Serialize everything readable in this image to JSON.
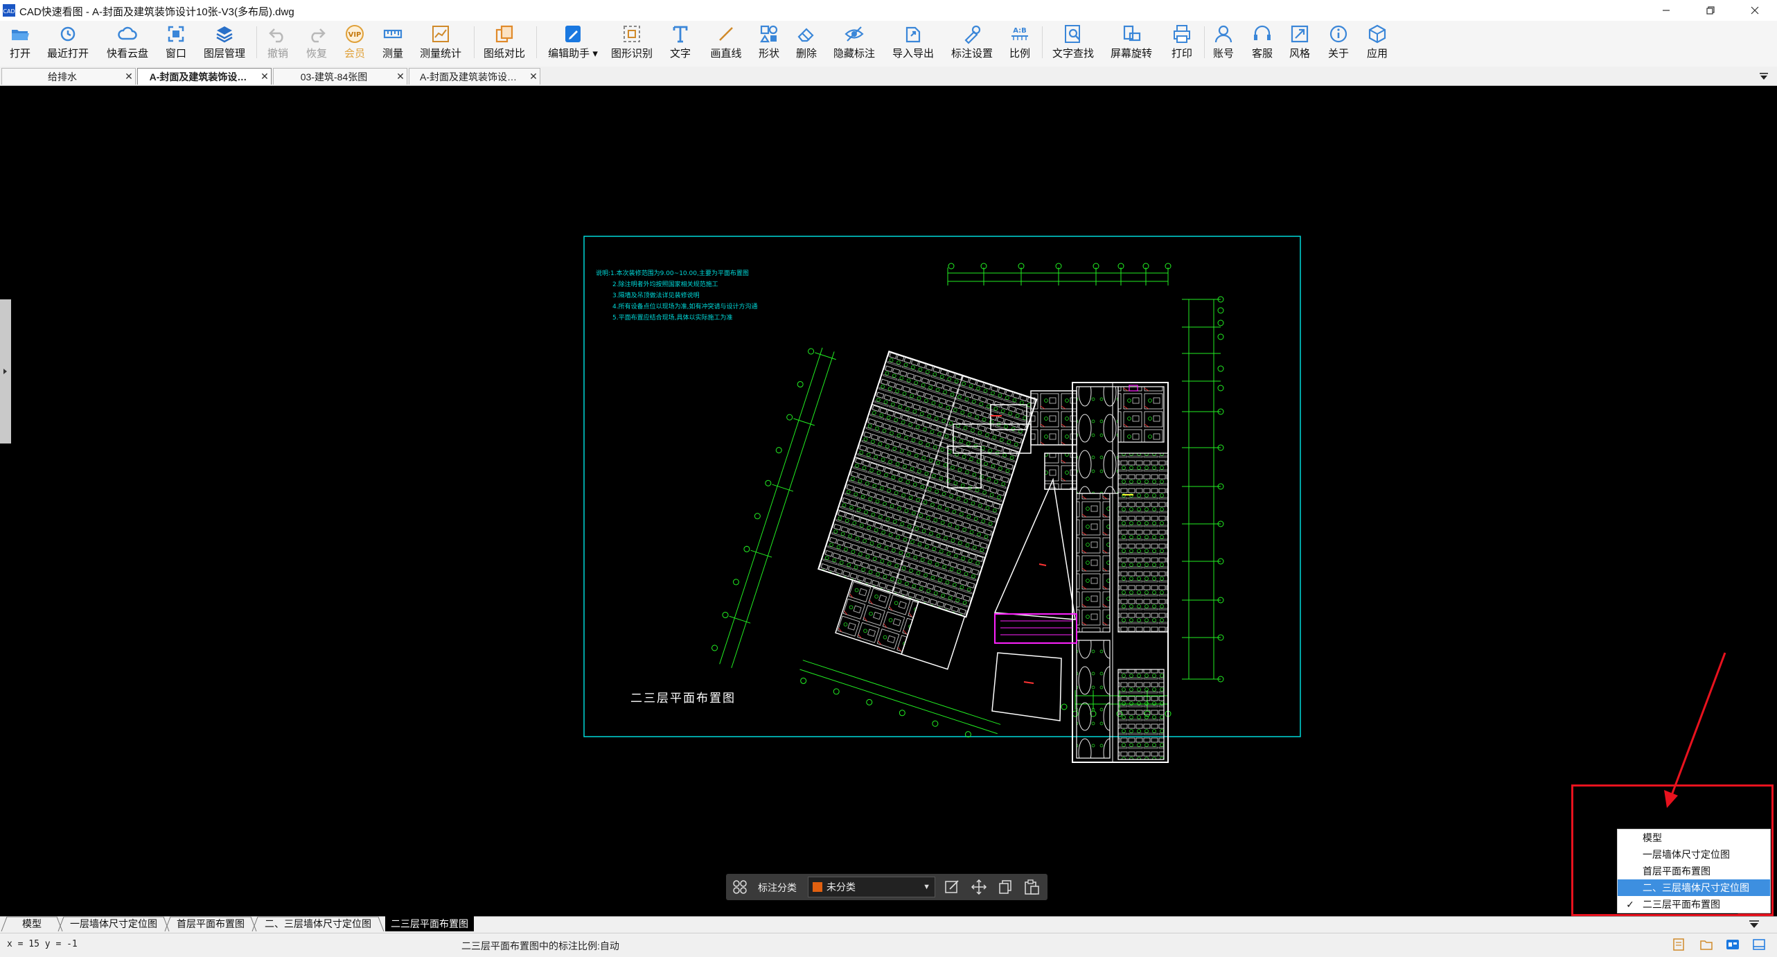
{
  "window": {
    "app_icon": "CAD",
    "title": "CAD快速看图 - A-封面及建筑装饰设计10张-V3(多布局).dwg",
    "minimize_icon": "minimize-icon",
    "restore_icon": "restore-icon",
    "close_icon": "close-icon"
  },
  "toolbar": {
    "open": "打开",
    "recent": "最近打开",
    "cloud": "快看云盘",
    "window": "窗口",
    "layers": "图层管理",
    "undo": "撤销",
    "redo": "恢复",
    "vip": "会员",
    "vip_badge": "VIP",
    "measure": "测量",
    "measure_stats": "测量统计",
    "compare": "图纸对比",
    "edit_assistant": "编辑助手",
    "shape_recognition": "图形识别",
    "text": "文字",
    "line": "画直线",
    "shape": "形状",
    "delete": "删除",
    "hide_annotation": "隐藏标注",
    "import_export": "导入导出",
    "annotation_settings": "标注设置",
    "scale": "比例",
    "scale_badge": "A:B",
    "text_search": "文字查找",
    "rotate": "屏幕旋转",
    "print": "打印",
    "account": "账号",
    "support": "客服",
    "style": "风格",
    "about": "关于",
    "apps": "应用"
  },
  "file_tabs": [
    {
      "label": "给排水"
    },
    {
      "label": "A-封面及建筑装饰设…"
    },
    {
      "label": "03-建筑-84张图"
    },
    {
      "label": "A-封面及建筑装饰设…"
    }
  ],
  "drawing": {
    "notes": [
      "说明:1.本次装修范围为9.00~10.00,主要为平面布置图",
      "2.除注明者外均按照国家相关规范施工",
      "3.隔墙及吊顶做法详见装修说明",
      "4.所有设备点位以现场为准,如有冲突请与设计方沟通",
      "5.平面布置应结合现场,具体以实际施工为准"
    ],
    "caption": "二三层平面布置图"
  },
  "annotation_bar": {
    "category_label": "标注分类",
    "category_value": "未分类"
  },
  "layout_tabs": [
    {
      "label": "模型"
    },
    {
      "label": "一层墙体尺寸定位图"
    },
    {
      "label": "首层平面布置图"
    },
    {
      "label": "二、三层墙体尺寸定位图"
    },
    {
      "label": "二三层平面布置图"
    }
  ],
  "layout_menu": {
    "items": [
      {
        "label": "模型",
        "checked": "",
        "highlighted": false
      },
      {
        "label": "一层墙体尺寸定位图",
        "checked": "",
        "highlighted": false
      },
      {
        "label": "首层平面布置图",
        "checked": "",
        "highlighted": false
      },
      {
        "label": "二、三层墙体尺寸定位图",
        "checked": "",
        "highlighted": true
      },
      {
        "label": "二三层平面布置图",
        "checked": "✓",
        "highlighted": false
      }
    ]
  },
  "status": {
    "coords": "x = 15 y = -1",
    "message": "二三层平面布置图中的标注比例:自动"
  },
  "colors": {
    "accent": "#3d8fe0",
    "highlight_red": "#e8121e",
    "cad_cyan": "#00d8d8",
    "cad_green": "#22ee22",
    "cad_magenta": "#ff22ff"
  }
}
